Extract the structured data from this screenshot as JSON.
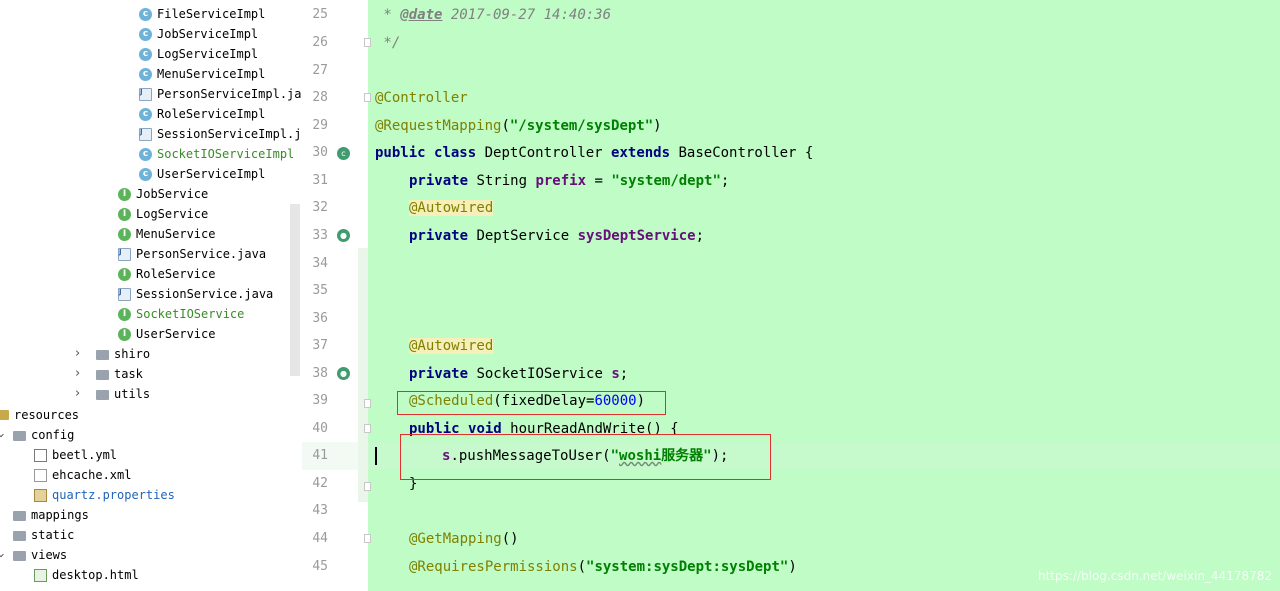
{
  "project_tree": {
    "items": [
      {
        "label": "FileServiceImpl",
        "icon": "class-icon",
        "color": "normal"
      },
      {
        "label": "JobServiceImpl",
        "icon": "class-icon",
        "color": "normal"
      },
      {
        "label": "LogServiceImpl",
        "icon": "class-icon",
        "color": "normal"
      },
      {
        "label": "MenuServiceImpl",
        "icon": "class-icon",
        "color": "normal"
      },
      {
        "label": "PersonServiceImpl.java",
        "icon": "java-file-icon",
        "color": "normal"
      },
      {
        "label": "RoleServiceImpl",
        "icon": "class-icon",
        "color": "normal"
      },
      {
        "label": "SessionServiceImpl.java",
        "icon": "java-file-icon",
        "color": "normal"
      },
      {
        "label": "SocketIOServiceImpl",
        "icon": "class-icon",
        "color": "green"
      },
      {
        "label": "UserServiceImpl",
        "icon": "class-icon",
        "color": "normal"
      },
      {
        "label": "JobService",
        "icon": "interface-icon",
        "color": "normal"
      },
      {
        "label": "LogService",
        "icon": "interface-icon",
        "color": "normal"
      },
      {
        "label": "MenuService",
        "icon": "interface-icon",
        "color": "normal"
      },
      {
        "label": "PersonService.java",
        "icon": "java-file-icon",
        "color": "normal"
      },
      {
        "label": "RoleService",
        "icon": "interface-icon",
        "color": "normal"
      },
      {
        "label": "SessionService.java",
        "icon": "java-file-icon",
        "color": "normal"
      },
      {
        "label": "SocketIOService",
        "icon": "interface-icon",
        "color": "green"
      },
      {
        "label": "UserService",
        "icon": "interface-icon",
        "color": "normal"
      },
      {
        "label": "shiro",
        "icon": "folder-icon",
        "color": "normal"
      },
      {
        "label": "task",
        "icon": "folder-icon",
        "color": "normal"
      },
      {
        "label": "utils",
        "icon": "folder-icon",
        "color": "normal"
      },
      {
        "label": "resources",
        "icon": "resources-folder-icon",
        "color": "normal"
      },
      {
        "label": "config",
        "icon": "folder-icon",
        "color": "normal"
      },
      {
        "label": "beetl.yml",
        "icon": "yml-file-icon",
        "color": "normal"
      },
      {
        "label": "ehcache.xml",
        "icon": "xml-file-icon",
        "color": "normal"
      },
      {
        "label": "quartz.properties",
        "icon": "properties-file-icon",
        "color": "blue"
      },
      {
        "label": "mappings",
        "icon": "folder-icon",
        "color": "normal"
      },
      {
        "label": "static",
        "icon": "folder-icon",
        "color": "normal"
      },
      {
        "label": "views",
        "icon": "folder-icon",
        "color": "normal"
      },
      {
        "label": "desktop.html",
        "icon": "html-file-icon",
        "color": "normal"
      }
    ]
  },
  "editor": {
    "line_numbers": [
      "25",
      "26",
      "27",
      "28",
      "29",
      "30",
      "31",
      "32",
      "33",
      "34",
      "35",
      "36",
      "37",
      "38",
      "39",
      "40",
      "41",
      "42",
      "43",
      "44",
      "45"
    ],
    "tokens": {
      "doc_star": " * ",
      "doc_tag": "@date",
      "doc_date": " 2017-09-27 14:40:36",
      "doc_end": " */",
      "ann_controller": "@Controller",
      "ann_requestmapping": "@RequestMapping",
      "str_sysdept_path": "\"/system/sysDept\"",
      "kw_public": "public",
      "kw_class": "class",
      "class_name": " DeptController ",
      "kw_extends": "extends",
      "base_class": " BaseController {",
      "kw_private": "private",
      "type_string": " String ",
      "field_prefix": "prefix",
      "assign": " = ",
      "str_system_dept": "\"system/dept\"",
      "semicolon": ";",
      "ann_autowired": "@Autowired",
      "type_deptservice": " DeptService ",
      "field_sysdeptservice": "sysDeptService",
      "type_socketio": " SocketIOService ",
      "field_s": "s",
      "ann_scheduled": "@Scheduled",
      "fixed_delay": "(fixedDelay=",
      "num_60000": "60000",
      "close_paren": ")",
      "kw_void": "void",
      "method_decl": " hourReadAndWrite() {",
      "push_call": ".pushMessageToUser(",
      "str_q1": "\"",
      "str_woshi": "woshi",
      "str_server": "服务器\"",
      "end_call": ");",
      "close_brace": "}",
      "ann_getmapping": "@GetMapping",
      "empty_parens": "()",
      "ann_requirespermissions": "@RequiresPermissions",
      "open_paren": "(",
      "str_permission": "\"system:sysDept:sysDept\""
    }
  },
  "watermark": "https://blog.csdn.net/weixin_44178782",
  "colors": {
    "editor_bg": "#bffcc6",
    "annotation_bg": "#f6efb9",
    "highlight_box": "#e03030"
  }
}
